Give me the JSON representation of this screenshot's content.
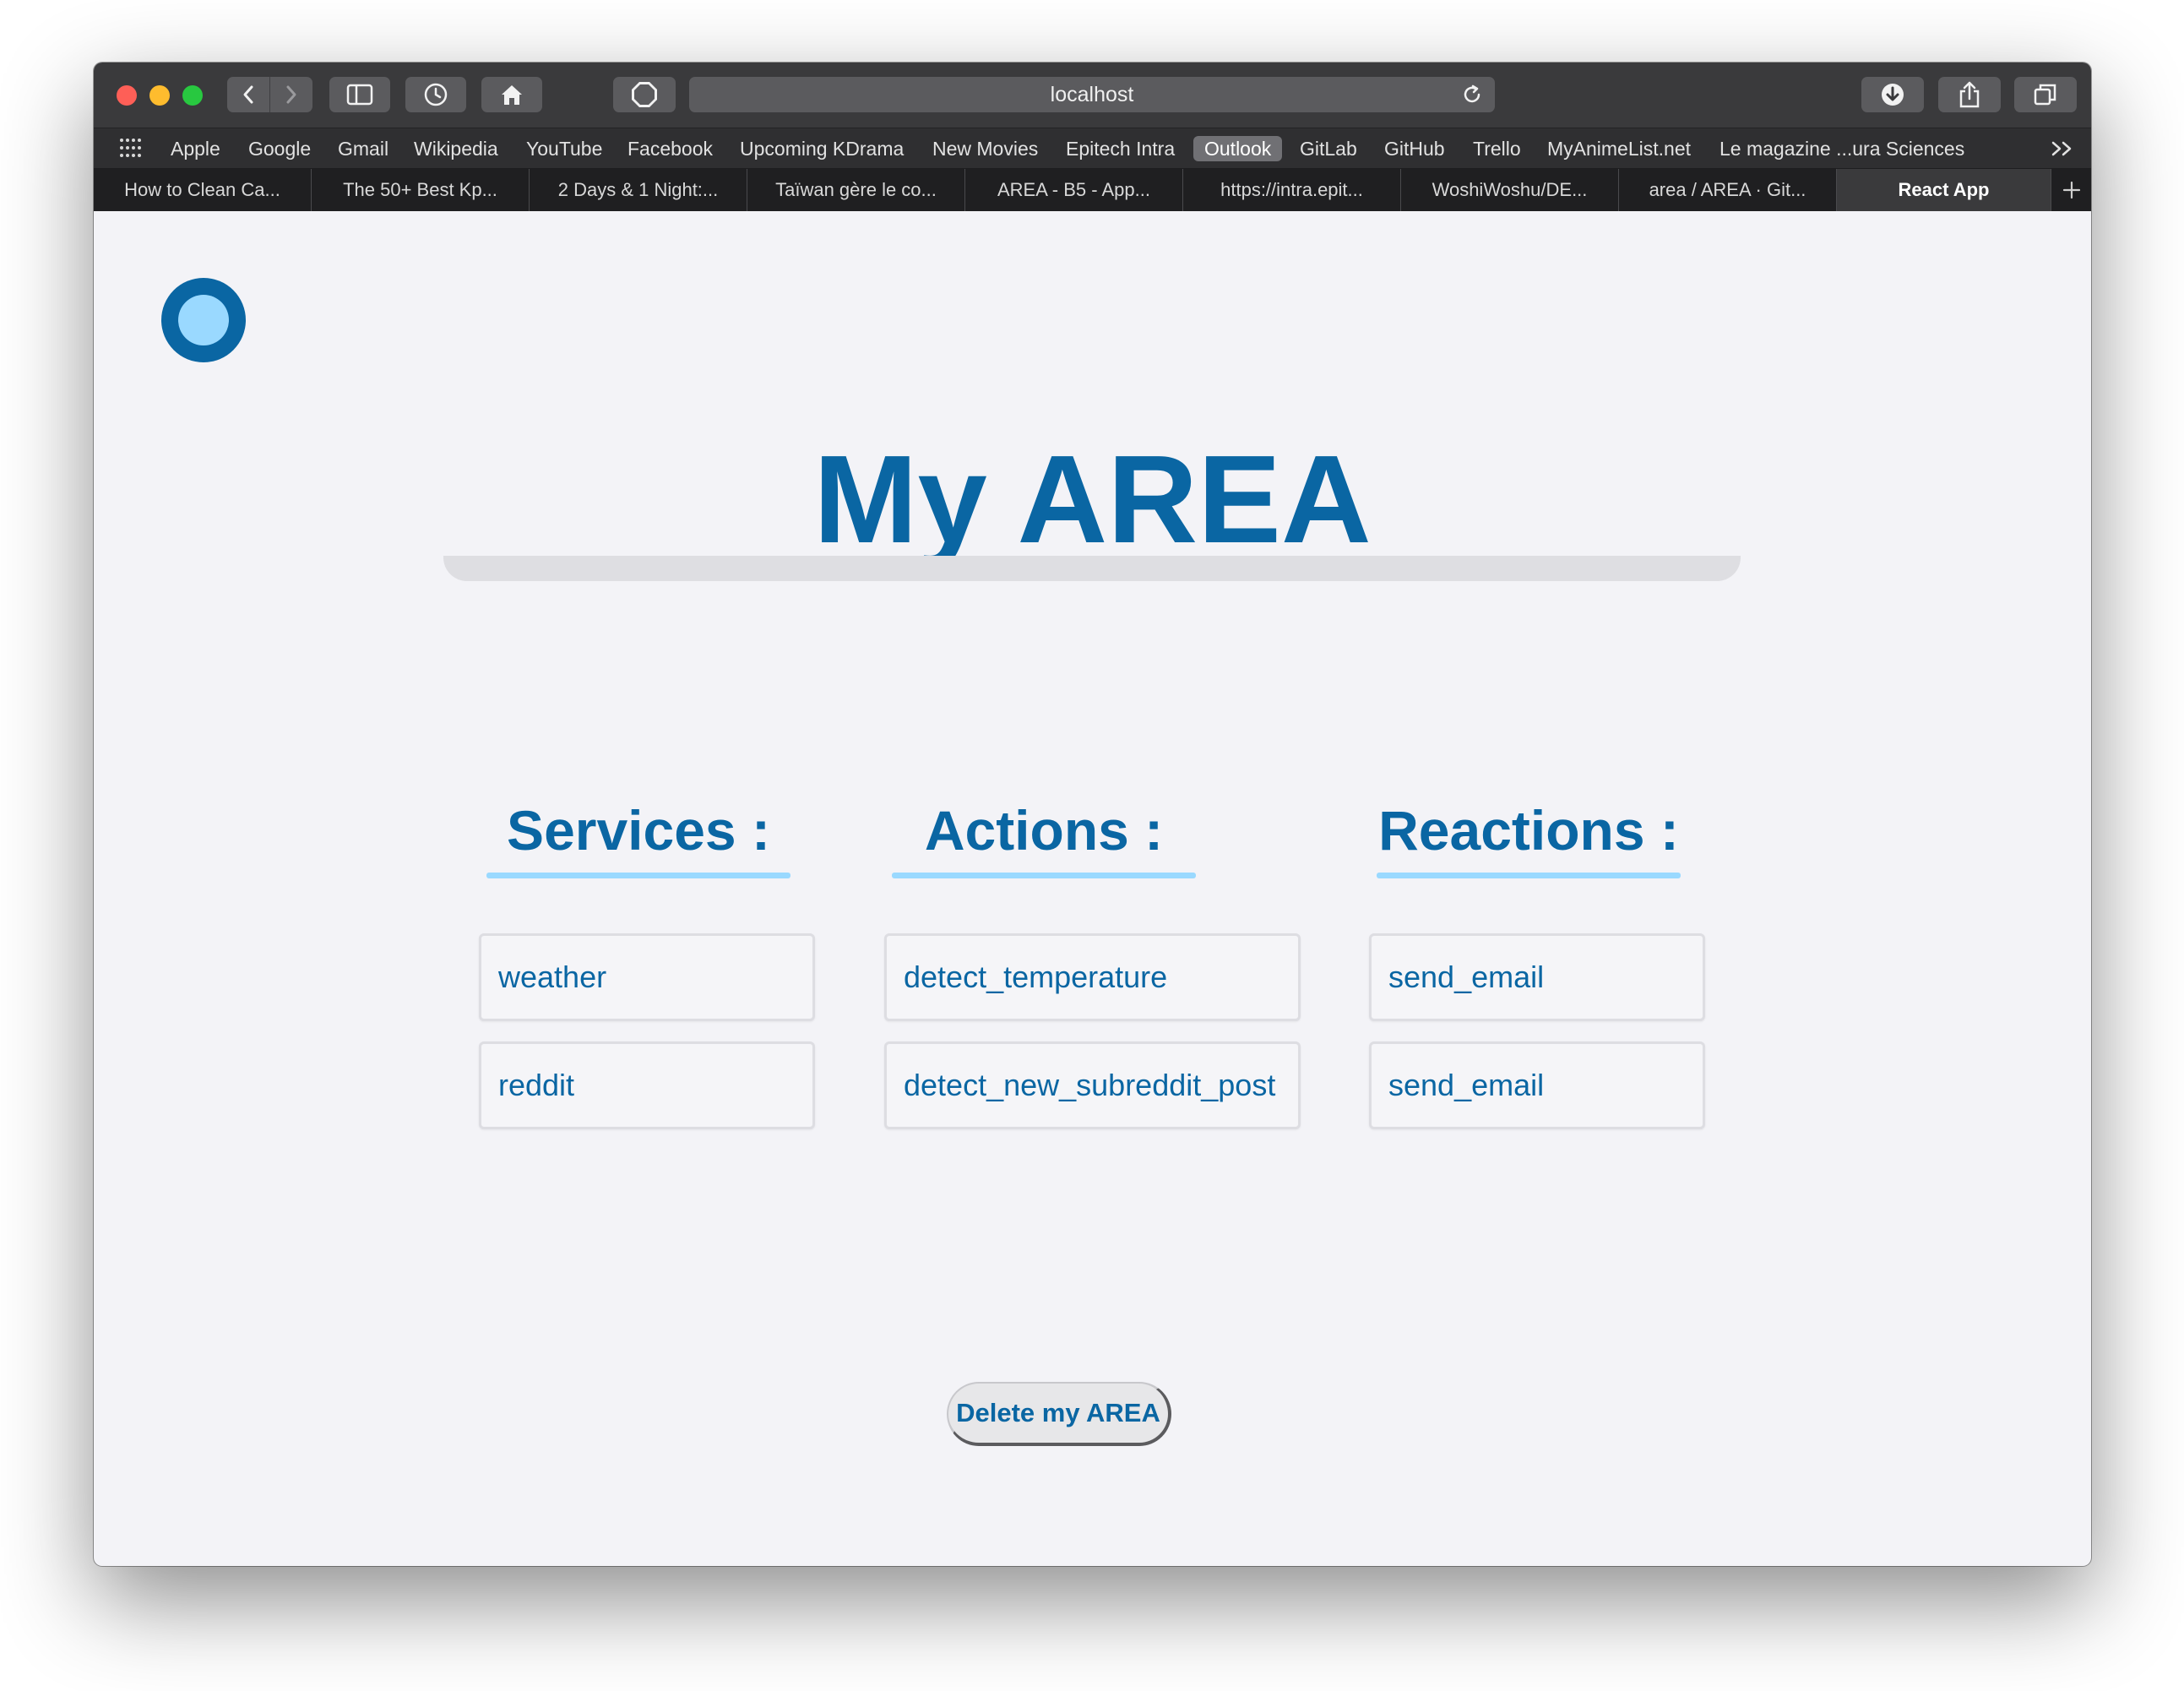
{
  "browser": {
    "url": "localhost",
    "bookmarks": [
      "Apple",
      "Google",
      "Gmail",
      "Wikipedia",
      "YouTube",
      "Facebook",
      "Upcoming KDrama",
      "New Movies",
      "Epitech Intra",
      "Outlook",
      "GitLab",
      "GitHub",
      "Trello",
      "MyAnimeList.net",
      "Le magazine ...ura Sciences"
    ],
    "active_bookmark": "Outlook",
    "tabs": [
      "How to Clean Ca...",
      "The 50+ Best Kp...",
      "2 Days & 1 Night:...",
      "Taïwan gère le co...",
      "AREA - B5 - App...",
      "https://intra.epit...",
      "WoshiWoshu/DE...",
      "area / AREA · Git...",
      "React App"
    ],
    "active_tab": "React App"
  },
  "page": {
    "title": "My AREA",
    "columns": [
      {
        "heading": "Services :",
        "items": [
          "weather",
          "reddit"
        ]
      },
      {
        "heading": "Actions :",
        "items": [
          "detect_temperature",
          "detect_new_subreddit_post"
        ]
      },
      {
        "heading": "Reactions :",
        "items": [
          "send_email",
          "send_email"
        ]
      }
    ],
    "delete_button": "Delete my AREA"
  },
  "colors": {
    "accent": "#0a66a3",
    "accent_light": "#9ad9ff",
    "page_background": "#f3f3f7"
  }
}
